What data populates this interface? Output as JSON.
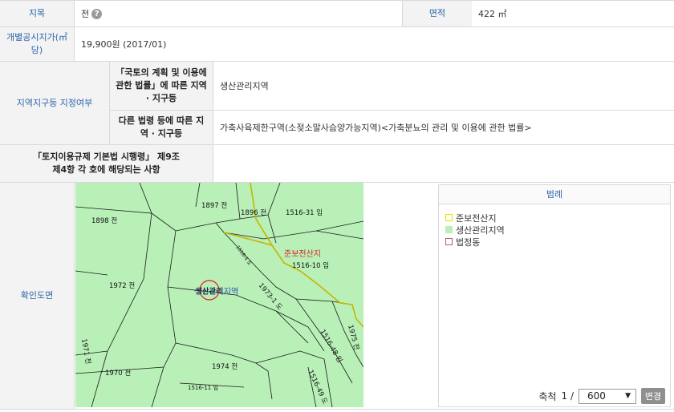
{
  "rows": {
    "jimok": {
      "label": "지목",
      "value": "전"
    },
    "area": {
      "label": "면적",
      "value": "422 ㎡"
    },
    "price": {
      "label": "개별공시지가(㎡당)",
      "value": "19,900원 (2017/01)"
    },
    "zoning": {
      "label": "지역지구등 지정여부",
      "law1_label": "「국토의 계획 및 이용에 관한 법률」에 따른 지역 · 지구등",
      "law1_value": "생산관리지역",
      "law2_label": "다른 법령 등에 따른 지역 · 지구등",
      "law2_value": "가축사육제한구역(소젖소말사슴양가능지역)<가축분뇨의 관리 및 이용에 관한 법률>"
    },
    "decree": {
      "label": "「토지이용규제 기본법 시행령」 제9조제4항 각 호에 해당되는 사항",
      "value": ""
    },
    "map": {
      "label": "확인도면"
    }
  },
  "map": {
    "parcels": [
      "1898 전",
      "1897 전",
      "1896 전",
      "1516-31 임",
      "1972 전",
      "1516-10 임",
      "1971 전",
      "1970 전",
      "1974 전",
      "1975 전",
      "1516-11 임",
      "1516-4 도",
      "1516-48 임",
      "1973-1 도",
      "1516-49 도"
    ],
    "overlay_red": "준보전산지",
    "overlay_zone": "생산관리지역",
    "target_label": "생산관리"
  },
  "legend": {
    "title": "범례",
    "items": [
      {
        "label": "준보전산지",
        "color": "#e8e000"
      },
      {
        "label": "생산관리지역",
        "color": "#b8f0b8"
      },
      {
        "label": "법정동",
        "color": "#aa6666"
      }
    ]
  },
  "scale": {
    "label": "축척",
    "prefix": "1 /",
    "value": "600",
    "button": "변경"
  }
}
